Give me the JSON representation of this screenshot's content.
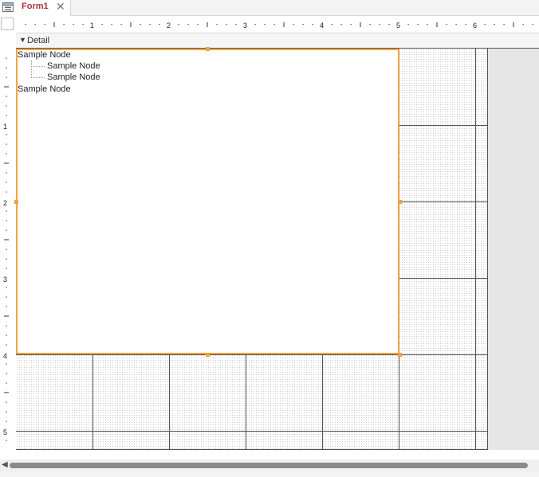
{
  "tab": {
    "title": "Form1",
    "close_glyph": "✕",
    "icon": "form-icon"
  },
  "section": {
    "label": "Detail",
    "arrow": "▼"
  },
  "ruler": {
    "top_numbers": [
      "1",
      "2",
      "3",
      "4",
      "5",
      "6"
    ],
    "left_numbers": [
      "1",
      "2",
      "3",
      "4",
      "5"
    ]
  },
  "treeview": {
    "nodes": [
      {
        "label": "Sample Node",
        "level": 0
      },
      {
        "label": "Sample Node",
        "level": 1
      },
      {
        "label": "Sample Node",
        "level": 1
      },
      {
        "label": "Sample Node",
        "level": 0
      }
    ]
  },
  "scrollbar": {
    "left_arrow": "◀"
  },
  "colors": {
    "selection": "#f4a23b",
    "tab_title": "#a4373a",
    "grid_line": "#555555"
  }
}
